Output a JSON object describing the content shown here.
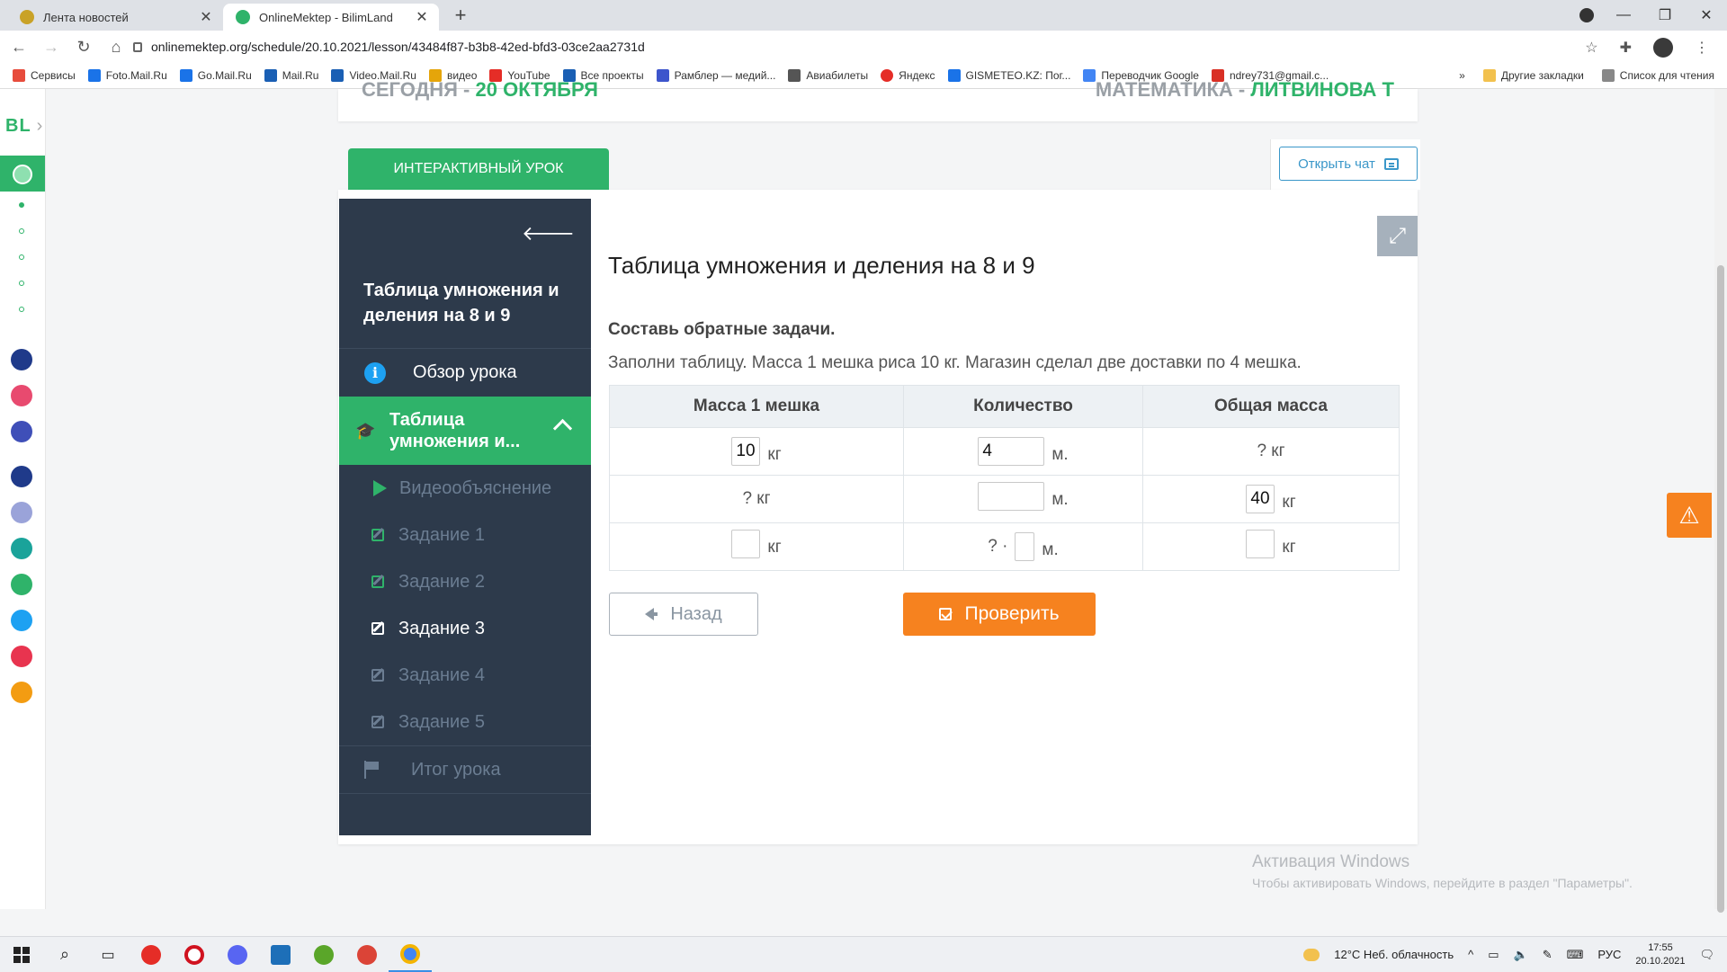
{
  "browser": {
    "tabs": [
      {
        "title": "Лента новостей",
        "active": false,
        "close": "✕"
      },
      {
        "title": "OnlineMektep - BilimLand",
        "active": true,
        "close": "✕"
      }
    ],
    "new_tab": "+",
    "url": "onlinemektep.org/schedule/20.10.2021/lesson/43484f87-b3b8-42ed-bfd3-03ce2aa2731d",
    "window_controls": [
      "—",
      "❐",
      "✕"
    ],
    "bookmarks": [
      {
        "label": "Сервисы",
        "color": "#e74c3c"
      },
      {
        "label": "Foto.Mail.Ru",
        "color": "#1a73e8"
      },
      {
        "label": "Go.Mail.Ru",
        "color": "#1a73e8"
      },
      {
        "label": "Mail.Ru",
        "color": "#1a5fb4"
      },
      {
        "label": "Video.Mail.Ru",
        "color": "#1a5fb4"
      },
      {
        "label": "видео",
        "color": "#e5a50a"
      },
      {
        "label": "YouTube",
        "color": "#e52d27"
      },
      {
        "label": "Все проекты",
        "color": "#1a5fb4"
      },
      {
        "label": "Рамблер — медий...",
        "color": "#3d55cc"
      },
      {
        "label": "Авиабилеты",
        "color": "#555555"
      },
      {
        "label": "Яндекс",
        "color": "#e52d27"
      },
      {
        "label": "GISMETEO.KZ: Пог...",
        "color": "#1a73e8"
      },
      {
        "label": "Переводчик Google",
        "color": "#4285f4"
      },
      {
        "label": "ndrey731@gmail.c...",
        "color": "#d93025"
      }
    ],
    "bookmarks_more": "»",
    "other_bookmarks": "Другие закладки",
    "reading_list": "Список для чтения"
  },
  "rail": {
    "logo": "BL",
    "icon_colors": [
      "#1f3a8a",
      "#e84a6f",
      "#3f4fb8",
      "#1f3a8a",
      "#9aa3d9",
      "#1aa39a",
      "#2fb36a",
      "#1da1f2",
      "#e8344f",
      "#f39c12"
    ]
  },
  "header": {
    "left_plain": "СЕГОДНЯ - ",
    "left_green": "20 ОКТЯБРЯ",
    "right_plain": "МАТЕМАТИКА - ",
    "right_green": "ЛИТВИНОВА Т"
  },
  "lesson_tab": "ИНТЕРАКТИВНЫЙ УРОК",
  "chat_button": "Открыть чат",
  "sidebar": {
    "back_icon": "🡐",
    "title": "Таблица умножения и деления на 8 и 9",
    "overview": "Обзор урока",
    "active_section": "Таблица умножения и...",
    "items": [
      {
        "label": "Видеообъяснение",
        "type": "video",
        "state": "dim"
      },
      {
        "label": "Задание 1",
        "type": "task",
        "state": "dim"
      },
      {
        "label": "Задание 2",
        "type": "task",
        "state": "dim"
      },
      {
        "label": "Задание 3",
        "type": "task",
        "state": "current"
      },
      {
        "label": "Задание 4",
        "type": "task",
        "state": "dim"
      },
      {
        "label": "Задание 5",
        "type": "task",
        "state": "dim"
      }
    ],
    "summary": "Итог урока"
  },
  "content": {
    "title": "Таблица умножения и деления на 8 и 9",
    "task_heading": "Составь обратные задачи.",
    "task_text": "Заполни таблицу. Масса 1 мешка риса 10 кг. Магазин сделал две доставки по 4 мешка.",
    "table": {
      "headers": [
        "Масса 1 мешка",
        "Количество",
        "Общая масса"
      ],
      "row1": {
        "mass_value": "10",
        "mass_unit": "кг",
        "count_value": "4",
        "count_unit": "м.",
        "total_text": "? кг"
      },
      "row2": {
        "mass_text": "? кг",
        "count_value": "",
        "count_unit": "м.",
        "total_value": "40",
        "total_unit": "кг"
      },
      "row3": {
        "mass_value": "",
        "mass_unit": "кг",
        "count_prefix": "? ·",
        "count_value": "",
        "count_unit": "м.",
        "total_value": "",
        "total_unit": "кг"
      }
    },
    "back_button": "Назад",
    "check_button": "Проверить"
  },
  "activation": {
    "line1": "Активация Windows",
    "line2": "Чтобы активировать Windows, перейдите в раздел \"Параметры\"."
  },
  "taskbar": {
    "weather": "12°C  Неб. облачность",
    "lang": "РУС",
    "time": "17:55",
    "date": "20.10.2021"
  }
}
